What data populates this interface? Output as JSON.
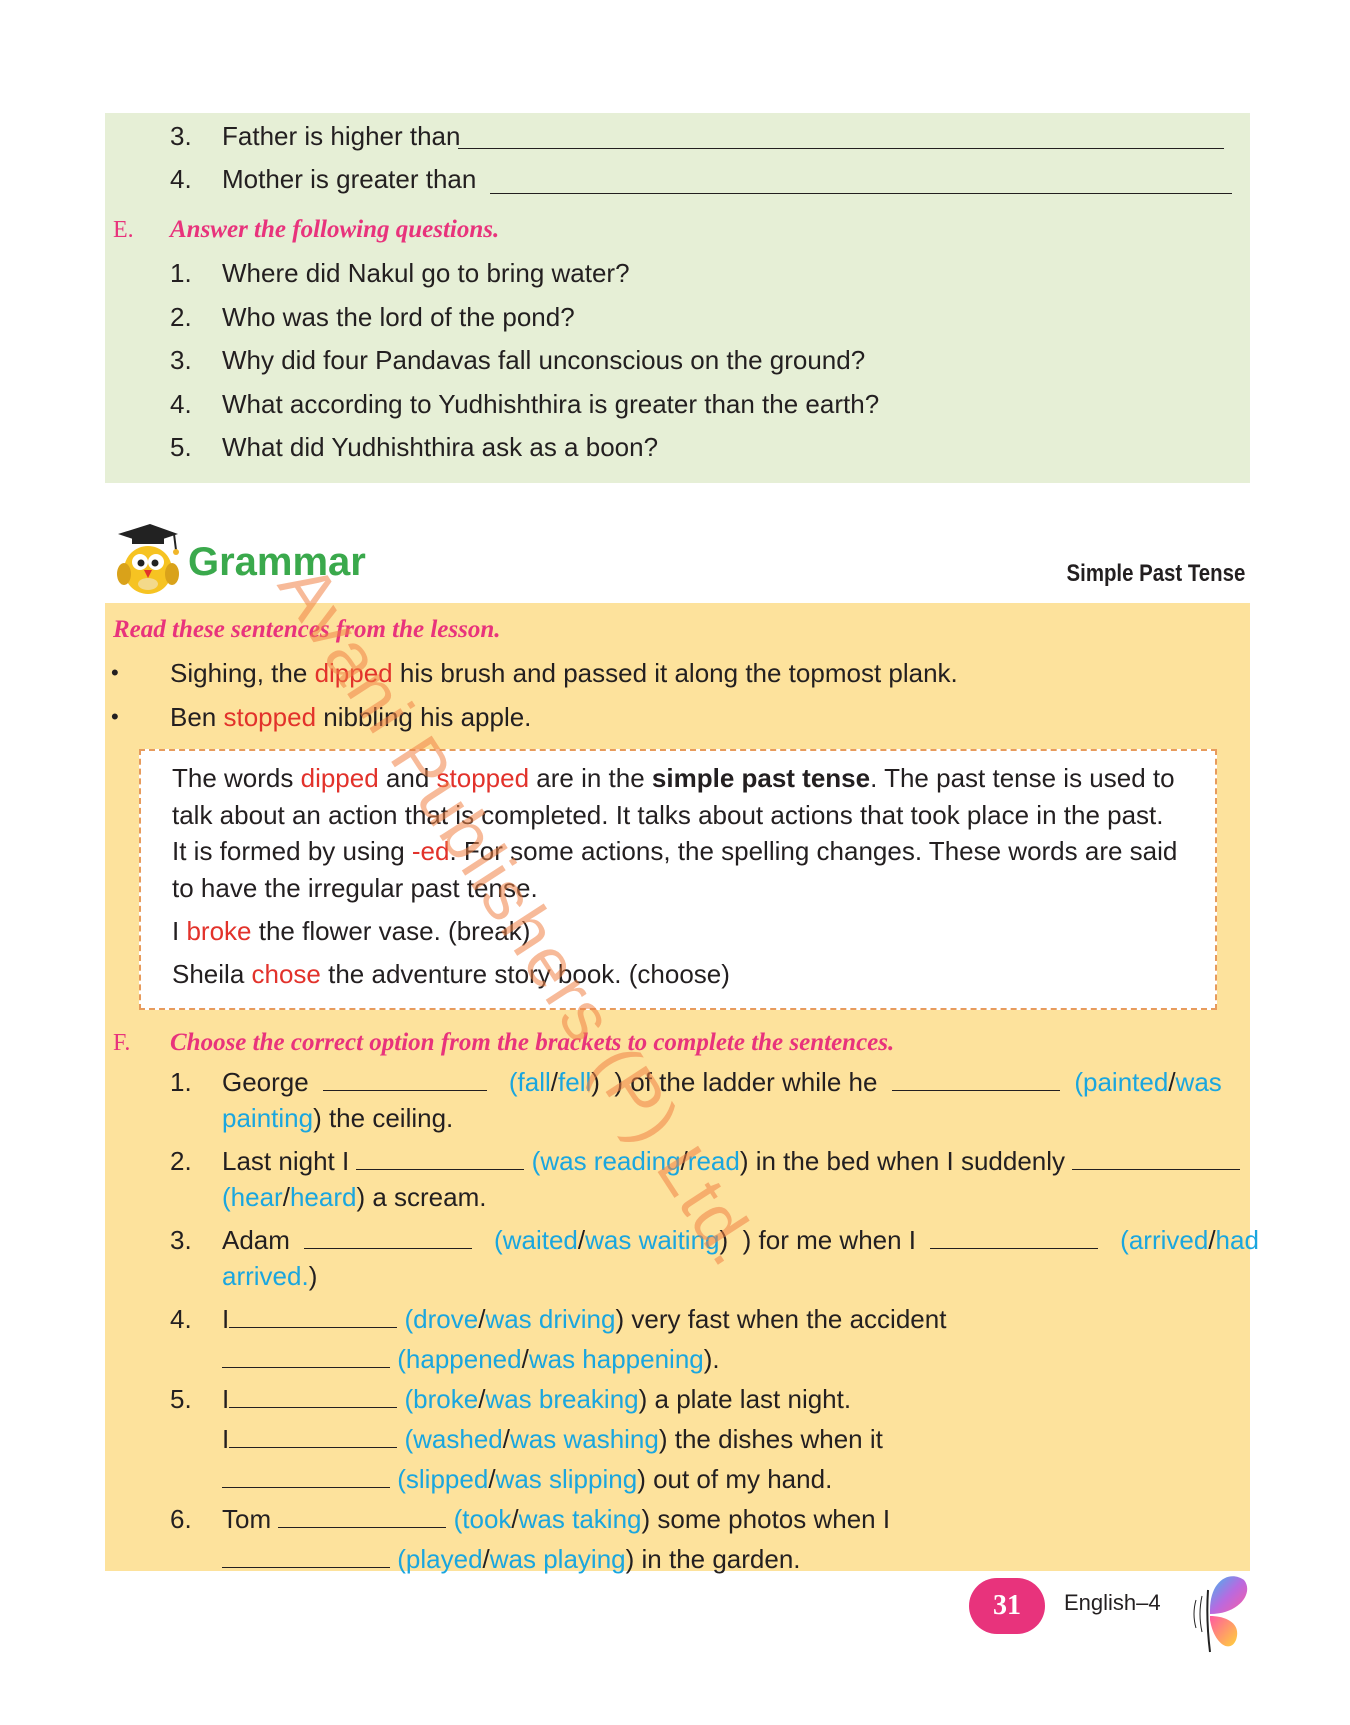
{
  "section_d": {
    "items": [
      {
        "num": "3.",
        "text": "Father is higher than"
      },
      {
        "num": "4.",
        "text": "Mother is greater than"
      }
    ]
  },
  "section_e": {
    "letter": "E.",
    "heading": "Answer the following questions.",
    "questions": [
      {
        "num": "1.",
        "text": "Where did Nakul go to bring water?"
      },
      {
        "num": "2.",
        "text": "Who was the lord of the pond?"
      },
      {
        "num": "3.",
        "text": "Why did four Pandavas fall unconscious on the ground?"
      },
      {
        "num": "4.",
        "text": "What according to Yudhishthira is greater than the earth?"
      },
      {
        "num": "5.",
        "text": "What did Yudhishthira ask as a boon?"
      }
    ]
  },
  "grammar": {
    "title": "Grammar",
    "topic": "Simple Past Tense",
    "read_heading": "Read these sentences from the lesson.",
    "bullets": [
      {
        "before": "Sighing, the ",
        "highlight": "dipped",
        "after": " his brush and passed it along the topmost plank."
      },
      {
        "before": "Ben ",
        "highlight": "stopped",
        "after": " nibbling his apple."
      }
    ],
    "info": {
      "l1_a": "The words ",
      "l1_b": "dipped",
      "l1_c": " and ",
      "l1_d": "stopped",
      "l1_e": " are in the ",
      "l1_f": "simple past tense",
      "l1_g": ". The past tense is used to",
      "l2": "talk about an action that is completed. It talks about actions that took place in the past.",
      "l3_a": "It is formed by using ",
      "l3_b": "-ed",
      "l3_c": ". For some actions, the spelling changes. These words are said",
      "l4": "to have the irregular past tense.",
      "ex1_a": "I ",
      "ex1_b": "broke",
      "ex1_c": " the flower vase. (break)",
      "ex2_a": "Sheila ",
      "ex2_b": "chose",
      "ex2_c": " the adventure story book. (choose)"
    }
  },
  "section_f": {
    "letter": "F.",
    "heading": "Choose the correct option from the brackets to complete the sentences.",
    "q1": {
      "num": "1.",
      "a": "George",
      "o1": "fall",
      "o2": "fell",
      "b": ") of the ladder while he",
      "o3": "painted",
      "o4": "was",
      "o4b": "painting",
      "c": ") the ceiling."
    },
    "q2": {
      "num": "2.",
      "a": "Last night I",
      "o1": "was reading",
      "o2": "read",
      "b": ") in the bed when I suddenly",
      "o3": "hear",
      "o4": "heard",
      "c": ") a scream."
    },
    "q3": {
      "num": "3.",
      "a": "Adam",
      "o1": "waited",
      "o2": "was waiting",
      "b": ") for me when I",
      "o3": "arrived",
      "o4": "had",
      "o4b": "arrived.",
      "c": ")"
    },
    "q4": {
      "num": "4.",
      "a": "I",
      "o1": "drove",
      "o2": "was driving",
      "b": ") very fast when the accident",
      "o3": "happened",
      "o4": "was happening",
      "c": ")."
    },
    "q5": {
      "num": "5.",
      "a": "I",
      "o1": "broke",
      "o2": "was breaking",
      "b": ") a plate last night.",
      "a2": "I",
      "o3": "washed",
      "o4": "was washing",
      "c": ") the dishes when it",
      "o5": "slipped",
      "o6": "was slipping",
      "d": ") out of my hand."
    },
    "q6": {
      "num": "6.",
      "a": "Tom",
      "o1": "took",
      "o2": "was taking",
      "b": ") some photos when I",
      "o3": "played",
      "o4": "was playing",
      "c": ") in the garden."
    }
  },
  "footer": {
    "page": "31",
    "book": "English–4"
  },
  "watermark": "Avani Publishers (P) Ltd.",
  "colors": {
    "green_bg": "#e6efd6",
    "yellow_bg": "#fde29c",
    "heading_pink": "#e8337c",
    "highlight_red": "#e2322b",
    "option_blue": "#1aa6df",
    "grammar_green": "#3aa94c"
  },
  "icons": {
    "mascot": "owl-graduate-icon",
    "butterfly": "butterfly-icon"
  }
}
